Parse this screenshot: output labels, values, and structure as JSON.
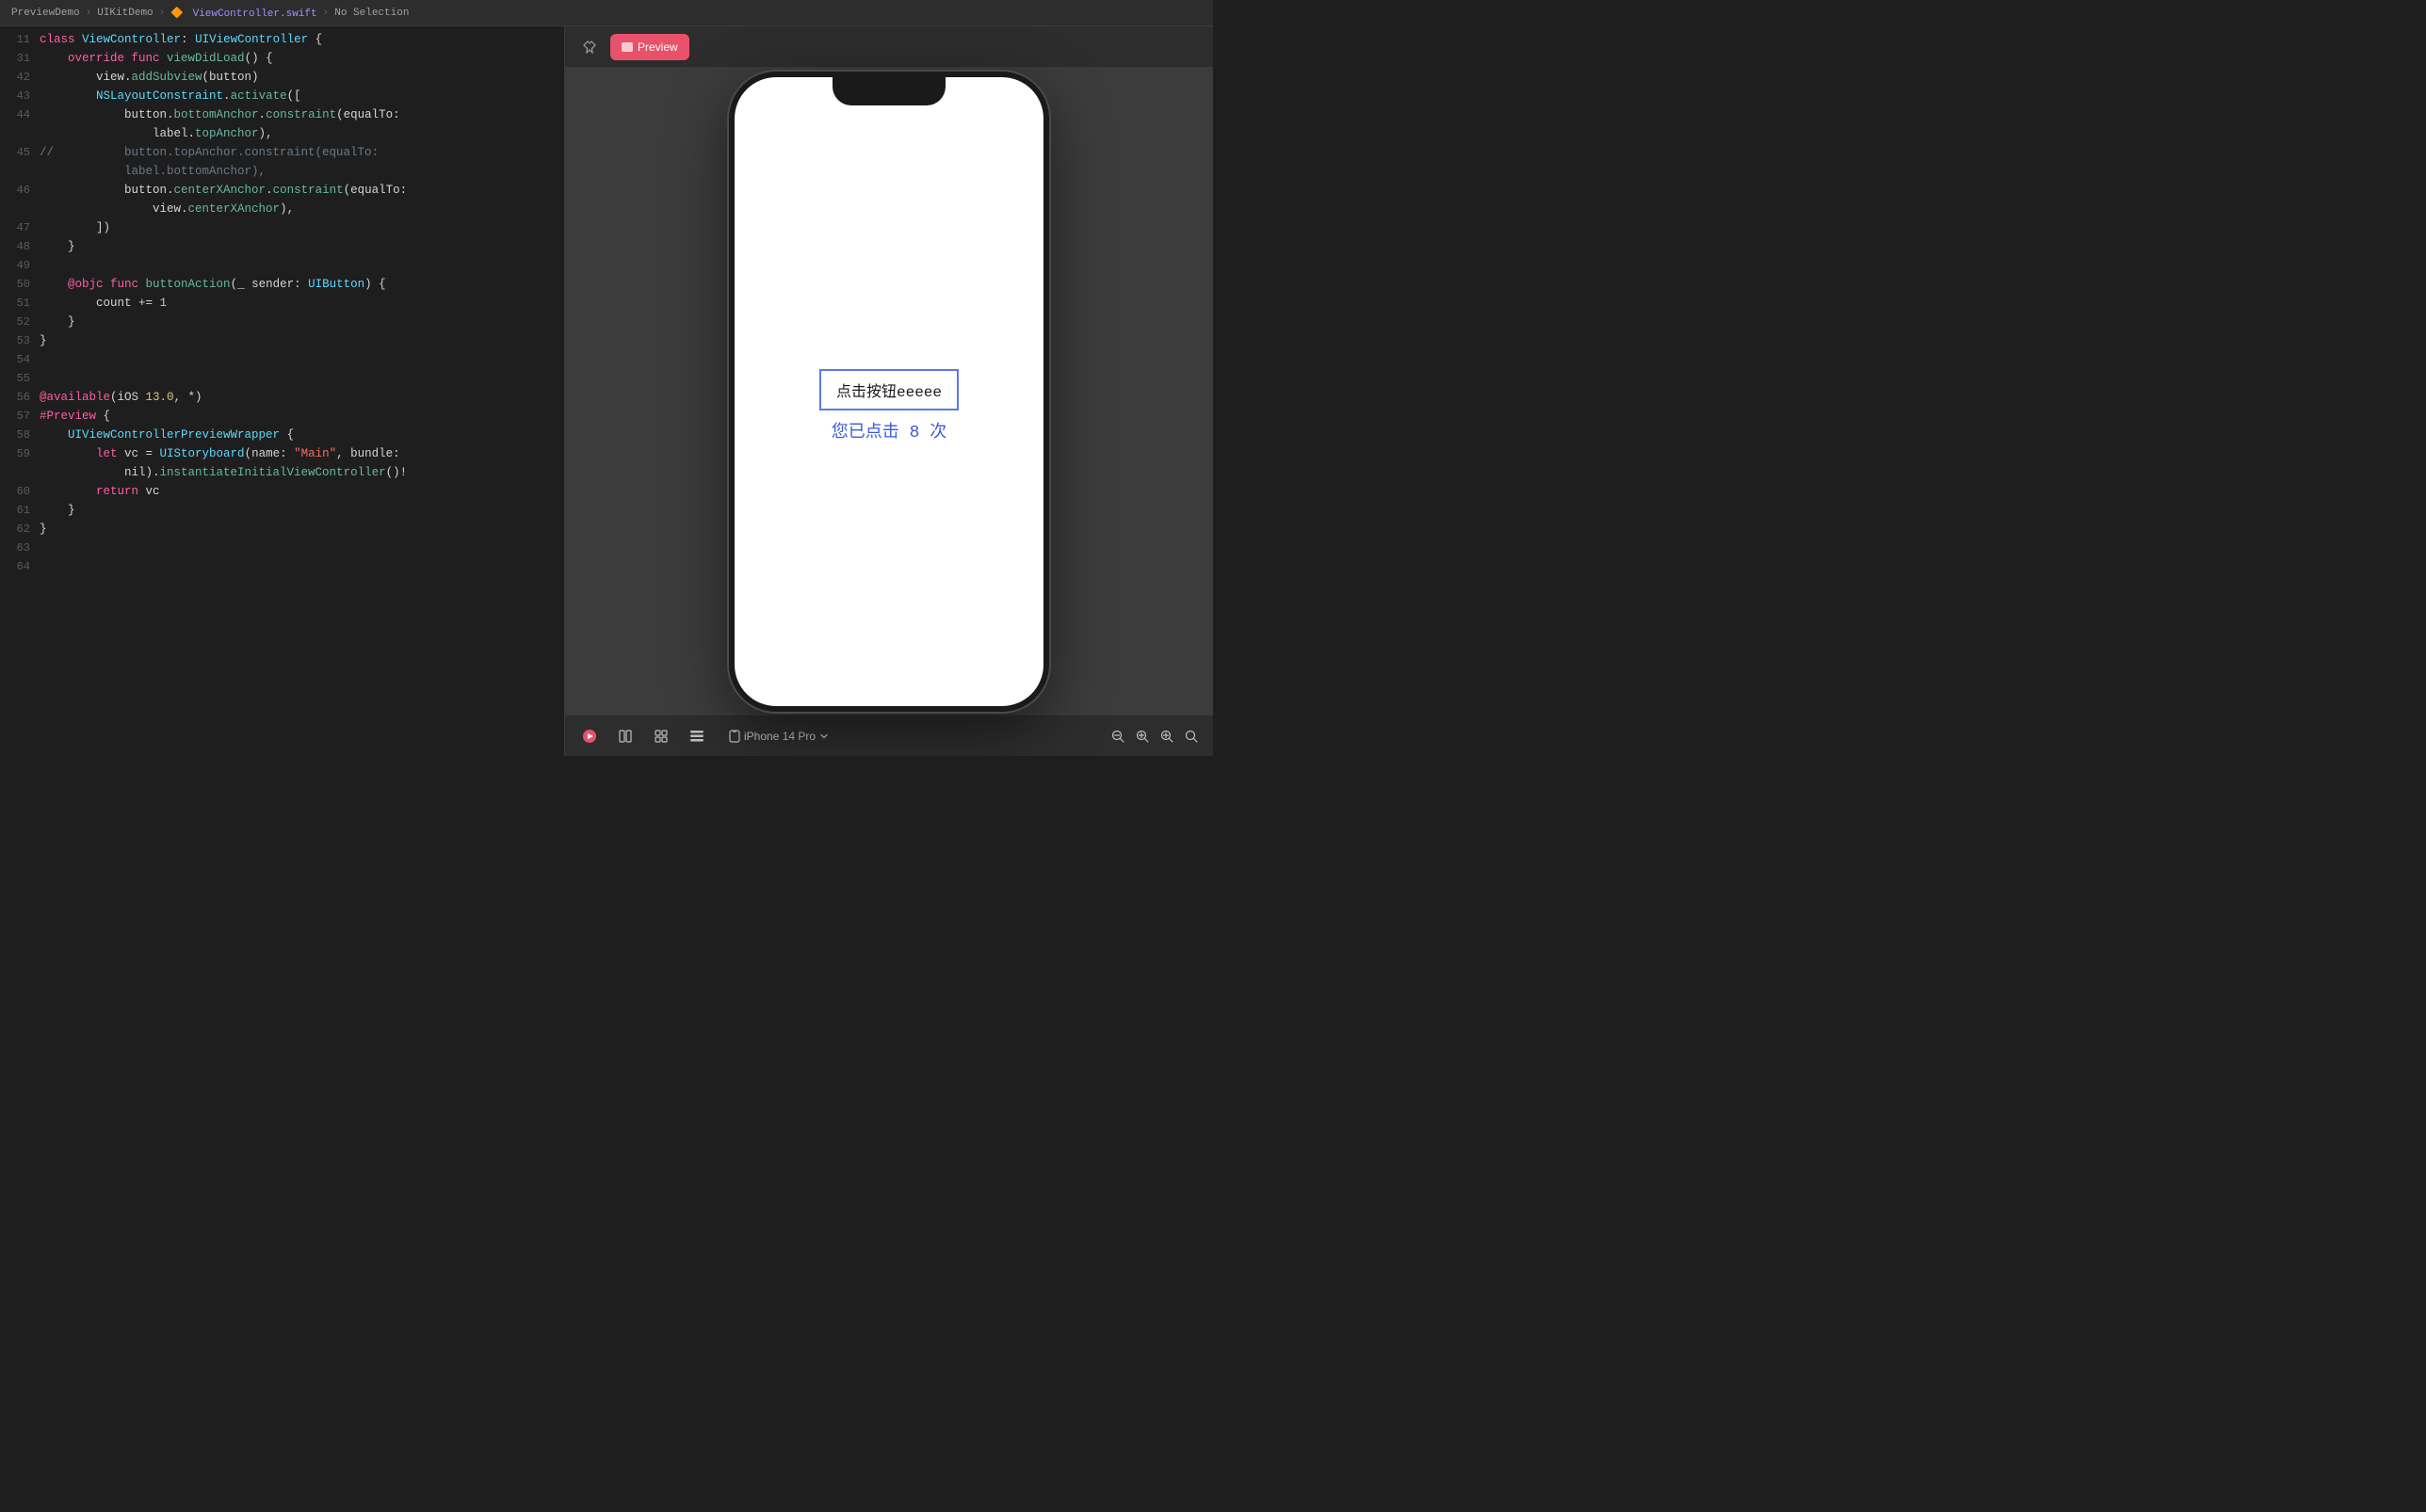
{
  "breadcrumb": {
    "project": "PreviewDemo",
    "sep1": "›",
    "group": "UIKitDemo",
    "sep2": "›",
    "file_icon": "swift-icon",
    "file": "ViewController.swift",
    "sep3": "›",
    "selection": "No Selection"
  },
  "toolbar": {
    "pin_label": "📌",
    "preview_label": "Preview"
  },
  "code": {
    "lines": [
      {
        "num": 11,
        "tokens": [
          {
            "t": "kw",
            "v": "class "
          },
          {
            "t": "type",
            "v": "ViewController"
          },
          {
            "t": "plain",
            "v": ": "
          },
          {
            "t": "type",
            "v": "UIViewController"
          },
          {
            "t": "plain",
            "v": " {"
          }
        ]
      },
      {
        "num": 31,
        "tokens": [
          {
            "t": "plain",
            "v": "    "
          },
          {
            "t": "kw",
            "v": "override "
          },
          {
            "t": "kw",
            "v": "func "
          },
          {
            "t": "method",
            "v": "viewDidLoad"
          },
          {
            "t": "plain",
            "v": "() {"
          }
        ]
      },
      {
        "num": 42,
        "tokens": [
          {
            "t": "plain",
            "v": "        view."
          },
          {
            "t": "method",
            "v": "addSubview"
          },
          {
            "t": "plain",
            "v": "(button)"
          }
        ]
      },
      {
        "num": 43,
        "tokens": [
          {
            "t": "plain",
            "v": "        "
          },
          {
            "t": "type",
            "v": "NSLayoutConstraint"
          },
          {
            "t": "plain",
            "v": "."
          },
          {
            "t": "method",
            "v": "activate"
          },
          {
            "t": "plain",
            "v": "(["
          }
        ]
      },
      {
        "num": 44,
        "tokens": [
          {
            "t": "plain",
            "v": "            button."
          },
          {
            "t": "method",
            "v": "bottomAnchor"
          },
          {
            "t": "plain",
            "v": "."
          },
          {
            "t": "method",
            "v": "constraint"
          },
          {
            "t": "plain",
            "v": "(equalTo:"
          },
          {
            "t": "plain",
            "v": " "
          }
        ]
      },
      {
        "num": "",
        "tokens": [
          {
            "t": "plain",
            "v": "                label."
          },
          {
            "t": "method",
            "v": "topAnchor"
          },
          {
            "t": "plain",
            "v": "),"
          }
        ]
      },
      {
        "num": 45,
        "tokens": [
          {
            "t": "comment",
            "v": "//          button.topAnchor.constraint(equalTo:"
          }
        ]
      },
      {
        "num": "",
        "tokens": [
          {
            "t": "comment",
            "v": "            label.bottomAnchor),"
          }
        ]
      },
      {
        "num": 46,
        "tokens": [
          {
            "t": "plain",
            "v": "            button."
          },
          {
            "t": "method",
            "v": "centerXAnchor"
          },
          {
            "t": "plain",
            "v": "."
          },
          {
            "t": "method",
            "v": "constraint"
          },
          {
            "t": "plain",
            "v": "(equalTo:"
          }
        ]
      },
      {
        "num": "",
        "tokens": [
          {
            "t": "plain",
            "v": "                view."
          },
          {
            "t": "method",
            "v": "centerXAnchor"
          },
          {
            "t": "plain",
            "v": "),"
          }
        ]
      },
      {
        "num": 47,
        "tokens": [
          {
            "t": "plain",
            "v": "        ])"
          }
        ]
      },
      {
        "num": 48,
        "tokens": [
          {
            "t": "plain",
            "v": "    }"
          }
        ]
      },
      {
        "num": 49,
        "tokens": []
      },
      {
        "num": 50,
        "tokens": [
          {
            "t": "plain",
            "v": "    "
          },
          {
            "t": "kw2",
            "v": "@objc "
          },
          {
            "t": "kw",
            "v": "func "
          },
          {
            "t": "method",
            "v": "buttonAction"
          },
          {
            "t": "plain",
            "v": "(_ sender: "
          },
          {
            "t": "type",
            "v": "UIButton"
          },
          {
            "t": "plain",
            "v": ") {"
          }
        ]
      },
      {
        "num": 51,
        "tokens": [
          {
            "t": "plain",
            "v": "        count += "
          },
          {
            "t": "num",
            "v": "1"
          }
        ]
      },
      {
        "num": 52,
        "tokens": [
          {
            "t": "plain",
            "v": "    }"
          }
        ]
      },
      {
        "num": 53,
        "tokens": [
          {
            "t": "plain",
            "v": "}"
          }
        ]
      },
      {
        "num": 54,
        "tokens": []
      },
      {
        "num": 55,
        "tokens": []
      },
      {
        "num": 56,
        "tokens": [
          {
            "t": "kw2",
            "v": "@available"
          },
          {
            "t": "plain",
            "v": "(iOS "
          },
          {
            "t": "num",
            "v": "13.0"
          },
          {
            "t": "plain",
            "v": ", *)"
          }
        ]
      },
      {
        "num": 57,
        "tokens": [
          {
            "t": "preview-kw",
            "v": "#Preview "
          },
          {
            "t": "plain",
            "v": "{"
          }
        ]
      },
      {
        "num": 58,
        "tokens": [
          {
            "t": "plain",
            "v": "    "
          },
          {
            "t": "type",
            "v": "UIViewControllerPreviewWrapper"
          },
          {
            "t": "plain",
            "v": " {"
          }
        ]
      },
      {
        "num": 59,
        "tokens": [
          {
            "t": "plain",
            "v": "        "
          },
          {
            "t": "kw",
            "v": "let "
          },
          {
            "t": "plain",
            "v": "vc = "
          },
          {
            "t": "type",
            "v": "UIStoryboard"
          },
          {
            "t": "plain",
            "v": "(name: "
          },
          {
            "t": "str",
            "v": "\"Main\""
          },
          {
            "t": "plain",
            "v": ", bundle:"
          }
        ]
      },
      {
        "num": "",
        "tokens": [
          {
            "t": "plain",
            "v": "            nil)."
          },
          {
            "t": "method",
            "v": "instantiateInitialViewController"
          },
          {
            "t": "plain",
            "v": "()!"
          }
        ]
      },
      {
        "num": 60,
        "tokens": [
          {
            "t": "plain",
            "v": "        "
          },
          {
            "t": "kw",
            "v": "return "
          },
          {
            "t": "plain",
            "v": "vc"
          }
        ]
      },
      {
        "num": 61,
        "tokens": [
          {
            "t": "plain",
            "v": "    }"
          }
        ]
      },
      {
        "num": 62,
        "tokens": [
          {
            "t": "plain",
            "v": "}"
          }
        ]
      },
      {
        "num": 63,
        "tokens": []
      },
      {
        "num": 64,
        "tokens": []
      }
    ]
  },
  "preview": {
    "title": "Preview",
    "device": "iPhone 14 Pro",
    "app_button_text": "点击按钮eeeee",
    "app_label_text": "您已点击 8 次",
    "zoom_in": "+",
    "zoom_out": "−",
    "zoom_fit": "⊡"
  }
}
